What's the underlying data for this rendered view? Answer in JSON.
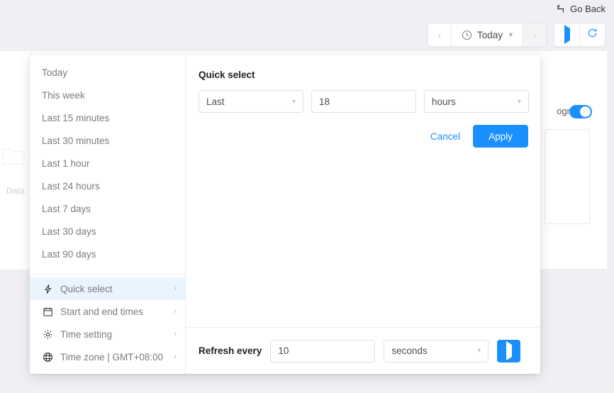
{
  "header": {
    "go_back_label": "Go Back",
    "go_back_icon": "return-arrow-icon",
    "toolbar": {
      "prev_label": "‹",
      "next_label": "›",
      "range_label": "Today",
      "clock_icon": "clock-icon",
      "chevron_icon": "chevron-down-icon",
      "play_icon": "play-icon",
      "refresh_icon": "refresh-icon"
    }
  },
  "background": {
    "data_label": "Data",
    "folder_icon": "folder-icon",
    "histogram_label": "ogram",
    "toggle_on": true
  },
  "popup": {
    "sidebar": {
      "quick_items": [
        {
          "label": "Today"
        },
        {
          "label": "This week"
        },
        {
          "label": "Last 15 minutes"
        },
        {
          "label": "Last 30 minutes"
        },
        {
          "label": "Last 1 hour"
        },
        {
          "label": "Last 24 hours"
        },
        {
          "label": "Last 7 days"
        },
        {
          "label": "Last 30 days"
        },
        {
          "label": "Last 90 days"
        }
      ],
      "nav_items": [
        {
          "label": "Quick select",
          "icon": "lightning-bolt-icon",
          "active": true,
          "chevron": "›"
        },
        {
          "label": "Start and end times",
          "icon": "calendar-icon",
          "active": false,
          "chevron": "›"
        },
        {
          "label": "Time setting",
          "icon": "gear-icon",
          "active": false,
          "chevron": "›"
        },
        {
          "label": "Time zone | GMT+08:00",
          "icon": "globe-icon",
          "active": false,
          "chevron": "›"
        }
      ]
    },
    "quick_select": {
      "title": "Quick select",
      "direction_value": "Last",
      "amount_value": "18",
      "unit_value": "hours",
      "cancel_label": "Cancel",
      "apply_label": "Apply",
      "chevron_icon": "chevron-down-icon"
    },
    "refresh": {
      "label": "Refresh every",
      "interval_value": "10",
      "unit_value": "seconds",
      "start_icon": "play-icon",
      "chevron_icon": "chevron-down-icon"
    }
  },
  "colors": {
    "accent": "#1a90ff",
    "active_row": "#e9f4fe",
    "page_bg": "#f0f0f4"
  }
}
